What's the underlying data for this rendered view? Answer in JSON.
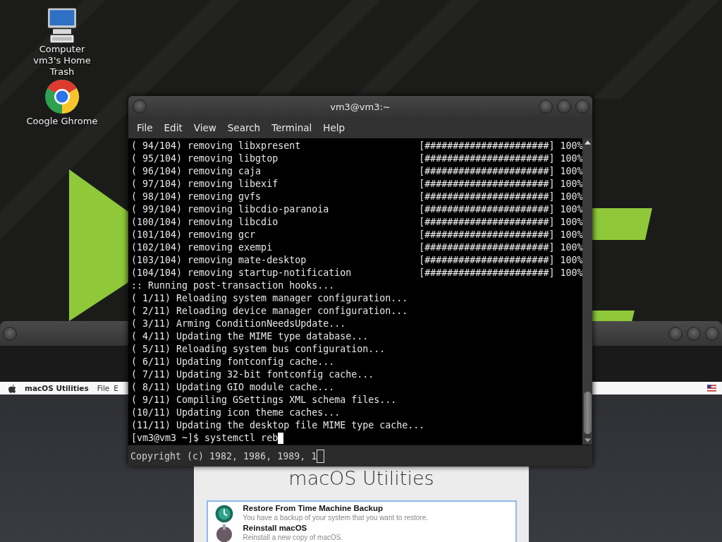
{
  "desktop_icons": [
    {
      "kind": "computer",
      "label": "Computer"
    },
    {
      "kind": "label-only",
      "label": "vm3's Home"
    },
    {
      "kind": "label-only",
      "label": "Trash"
    },
    {
      "kind": "browser",
      "label": "Coogle Ghrome"
    }
  ],
  "vm_window": {
    "menu_bar": {
      "app": "macOS Utilities",
      "items": [
        "File",
        "E"
      ]
    },
    "utilities": {
      "title": "macOS Utilities",
      "options": [
        {
          "kind": "time-machine",
          "title": "Restore From Time Machine Backup",
          "description": "You have a backup of your system that you want to restore."
        },
        {
          "kind": "installer",
          "title": "Reinstall macOS",
          "description": "Reinstall a new copy of macOS."
        }
      ]
    }
  },
  "terminal": {
    "title": "vm3@vm3:~",
    "menu": [
      "File",
      "Edit",
      "View",
      "Search",
      "Terminal",
      "Help"
    ],
    "lines": [
      {
        "kind": "package",
        "text": "( 94/104) removing libxpresent",
        "bar": "[######################] 100%"
      },
      {
        "kind": "package",
        "text": "( 95/104) removing libgtop",
        "bar": "[######################] 100%"
      },
      {
        "kind": "package",
        "text": "( 96/104) removing caja",
        "bar": "[######################] 100%"
      },
      {
        "kind": "package",
        "text": "( 97/104) removing libexif",
        "bar": "[######################] 100%"
      },
      {
        "kind": "package",
        "text": "( 98/104) removing gvfs",
        "bar": "[######################] 100%"
      },
      {
        "kind": "package",
        "text": "( 99/104) removing libcdio-paranoia",
        "bar": "[######################] 100%"
      },
      {
        "kind": "package",
        "text": "(100/104) removing libcdio",
        "bar": "[######################] 100%"
      },
      {
        "kind": "package",
        "text": "(101/104) removing gcr",
        "bar": "[######################] 100%"
      },
      {
        "kind": "package",
        "text": "(102/104) removing exempi",
        "bar": "[######################] 100%"
      },
      {
        "kind": "package",
        "text": "(103/104) removing mate-desktop",
        "bar": "[######################] 100%"
      },
      {
        "kind": "package",
        "text": "(104/104) removing startup-notification",
        "bar": "[######################] 100%"
      },
      {
        "kind": "plain",
        "text": ":: Running post-transaction hooks..."
      },
      {
        "kind": "plain",
        "text": "( 1/11) Reloading system manager configuration..."
      },
      {
        "kind": "plain",
        "text": "( 2/11) Reloading device manager configuration..."
      },
      {
        "kind": "plain",
        "text": "( 3/11) Arming ConditionNeedsUpdate..."
      },
      {
        "kind": "plain",
        "text": "( 4/11) Updating the MIME type database..."
      },
      {
        "kind": "plain",
        "text": "( 5/11) Reloading system bus configuration..."
      },
      {
        "kind": "plain",
        "text": "( 6/11) Updating fontconfig cache..."
      },
      {
        "kind": "plain",
        "text": "( 7/11) Updating 32-bit fontconfig cache..."
      },
      {
        "kind": "plain",
        "text": "( 8/11) Updating GIO module cache..."
      },
      {
        "kind": "plain",
        "text": "( 9/11) Compiling GSettings XML schema files..."
      },
      {
        "kind": "plain",
        "text": "(10/11) Updating icon theme caches..."
      },
      {
        "kind": "plain",
        "text": "(11/11) Updating the desktop file MIME type cache..."
      },
      {
        "kind": "prompt",
        "text": "[vm3@vm3 ~]$ systemctl reb"
      }
    ],
    "console_line": "Copyright (c) 1982, 1986, 1989, 1"
  }
}
